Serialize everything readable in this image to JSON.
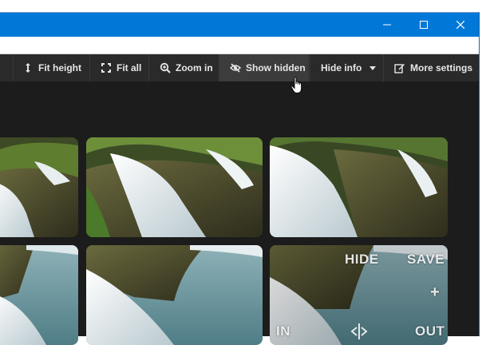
{
  "window_controls": {
    "minimize_icon": "minimize-icon",
    "maximize_icon": "maximize-icon",
    "close_icon": "close-icon"
  },
  "toolbar": {
    "fit_height": "Fit height",
    "fit_all": "Fit all",
    "zoom_in": "Zoom in",
    "show_hidden": "Show hidden",
    "hide_info": "Hide info",
    "more_settings": "More settings"
  },
  "overlay": {
    "hide": "HIDE",
    "save": "SAVE",
    "plus": "+",
    "in": "IN",
    "out": "OUT"
  },
  "colors": {
    "title_bar": "#0078d7",
    "toolbar": "#2a2a2a",
    "content": "#1c1c1c"
  }
}
